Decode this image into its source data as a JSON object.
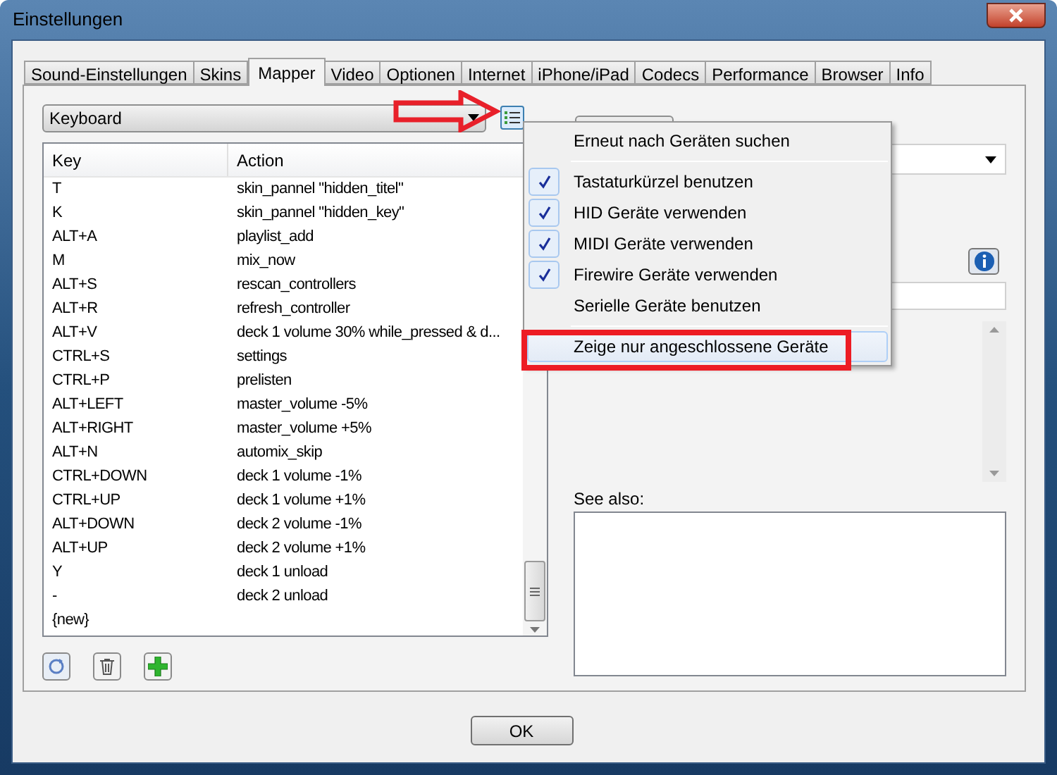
{
  "window": {
    "title": "Einstellungen"
  },
  "tabs": [
    {
      "label": "Sound-Einstellungen",
      "selected": false
    },
    {
      "label": "Skins",
      "selected": false
    },
    {
      "label": "Mapper",
      "selected": true
    },
    {
      "label": "Video",
      "selected": false
    },
    {
      "label": "Optionen",
      "selected": false
    },
    {
      "label": "Internet",
      "selected": false
    },
    {
      "label": "iPhone/iPad",
      "selected": false
    },
    {
      "label": "Codecs",
      "selected": false
    },
    {
      "label": "Performance",
      "selected": false
    },
    {
      "label": "Browser",
      "selected": false
    },
    {
      "label": "Info",
      "selected": false
    }
  ],
  "device_select": {
    "value": "Keyboard"
  },
  "table": {
    "columns": [
      "Key",
      "Action"
    ],
    "rows": [
      [
        "T",
        "skin_pannel \"hidden_titel\""
      ],
      [
        "K",
        "skin_pannel \"hidden_key\""
      ],
      [
        "ALT+A",
        "playlist_add"
      ],
      [
        "M",
        "mix_now"
      ],
      [
        "ALT+S",
        "rescan_controllers"
      ],
      [
        "ALT+R",
        "refresh_controller"
      ],
      [
        "ALT+V",
        "deck 1 volume 30% while_pressed & d..."
      ],
      [
        "CTRL+S",
        "settings"
      ],
      [
        "CTRL+P",
        "prelisten"
      ],
      [
        "ALT+LEFT",
        "master_volume -5%"
      ],
      [
        "ALT+RIGHT",
        "master_volume +5%"
      ],
      [
        "ALT+N",
        "automix_skip"
      ],
      [
        "CTRL+DOWN",
        "deck 1 volume -1%"
      ],
      [
        "CTRL+UP",
        "deck 1 volume +1%"
      ],
      [
        "ALT+DOWN",
        "deck 2 volume -1%"
      ],
      [
        "ALT+UP",
        "deck 2 volume +1%"
      ],
      [
        "Y",
        "deck 1 unload"
      ],
      [
        "-",
        "deck 2 unload"
      ],
      [
        "{new}",
        ""
      ]
    ]
  },
  "menu": {
    "items": [
      {
        "kind": "command",
        "label": "Erneut nach Geräten suchen",
        "highlighted": false
      },
      {
        "kind": "separator"
      },
      {
        "kind": "check",
        "label": "Tastaturkürzel benutzen",
        "checked": true,
        "highlighted": false
      },
      {
        "kind": "check",
        "label": "HID Geräte verwenden",
        "checked": true,
        "highlighted": false
      },
      {
        "kind": "check",
        "label": "MIDI Geräte verwenden",
        "checked": true,
        "highlighted": false
      },
      {
        "kind": "check",
        "label": "Firewire Geräte verwenden",
        "checked": true,
        "highlighted": false
      },
      {
        "kind": "check",
        "label": "Serielle Geräte benutzen",
        "checked": false,
        "highlighted": false
      },
      {
        "kind": "separator"
      },
      {
        "kind": "command",
        "label": "Zeige nur angeschlossene Geräte",
        "highlighted": true
      }
    ]
  },
  "see_also": {
    "label": "See also:"
  },
  "buttons": [
    "OK"
  ]
}
